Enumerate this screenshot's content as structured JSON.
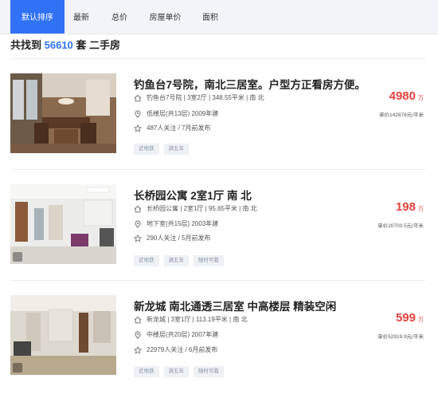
{
  "tabs": [
    "默认排序",
    "最新",
    "总价",
    "房屋单价",
    "面积"
  ],
  "result": {
    "prefix": "共找到",
    "count": "56610",
    "suffix": "套 二手房"
  },
  "listings": [
    {
      "title": "钓鱼台7号院，南北三居室。户型方正看房方便。",
      "info": "钓鱼台7号院 | 3室2厅 | 348.55平米 | 南 北",
      "floor": "低楼层(共13层) 2009年建",
      "follow": "487人关注 / 7月前发布",
      "tags": [
        "近地铁",
        "满五年"
      ],
      "price": "4980",
      "price_unit": "万",
      "unit_price": "单价142878元/平米"
    },
    {
      "title": "长桥园公寓 2室1厅 南 北",
      "info": "长桥园公寓 | 2室1厅 | 95.65平米 | 南 北",
      "floor": "地下室(共15层) 2003年建",
      "follow": "290人关注 / 5月前发布",
      "tags": [
        "近地铁",
        "满五年",
        "随时可看"
      ],
      "price": "198",
      "price_unit": "万",
      "unit_price": "单价20700.5元/平米"
    },
    {
      "title": "新龙城 南北通透三居室 中高楼层 精装空闲",
      "info": "新龙城 | 3室1厅 | 113.19平米 | 南 北",
      "floor": "中楼层(共20层) 2007年建",
      "follow": "22979人关注 / 6月前发布",
      "tags": [
        "近地铁",
        "满五年",
        "随时可看"
      ],
      "price": "599",
      "price_unit": "万",
      "unit_price": "单价52919.9元/平米"
    }
  ],
  "icons": {
    "home": "house-icon",
    "floor": "location-pin-icon",
    "follow": "star-icon",
    "vr": "vr-icon"
  },
  "colors": {
    "accent": "#3072f6",
    "price": "#e2433c"
  }
}
